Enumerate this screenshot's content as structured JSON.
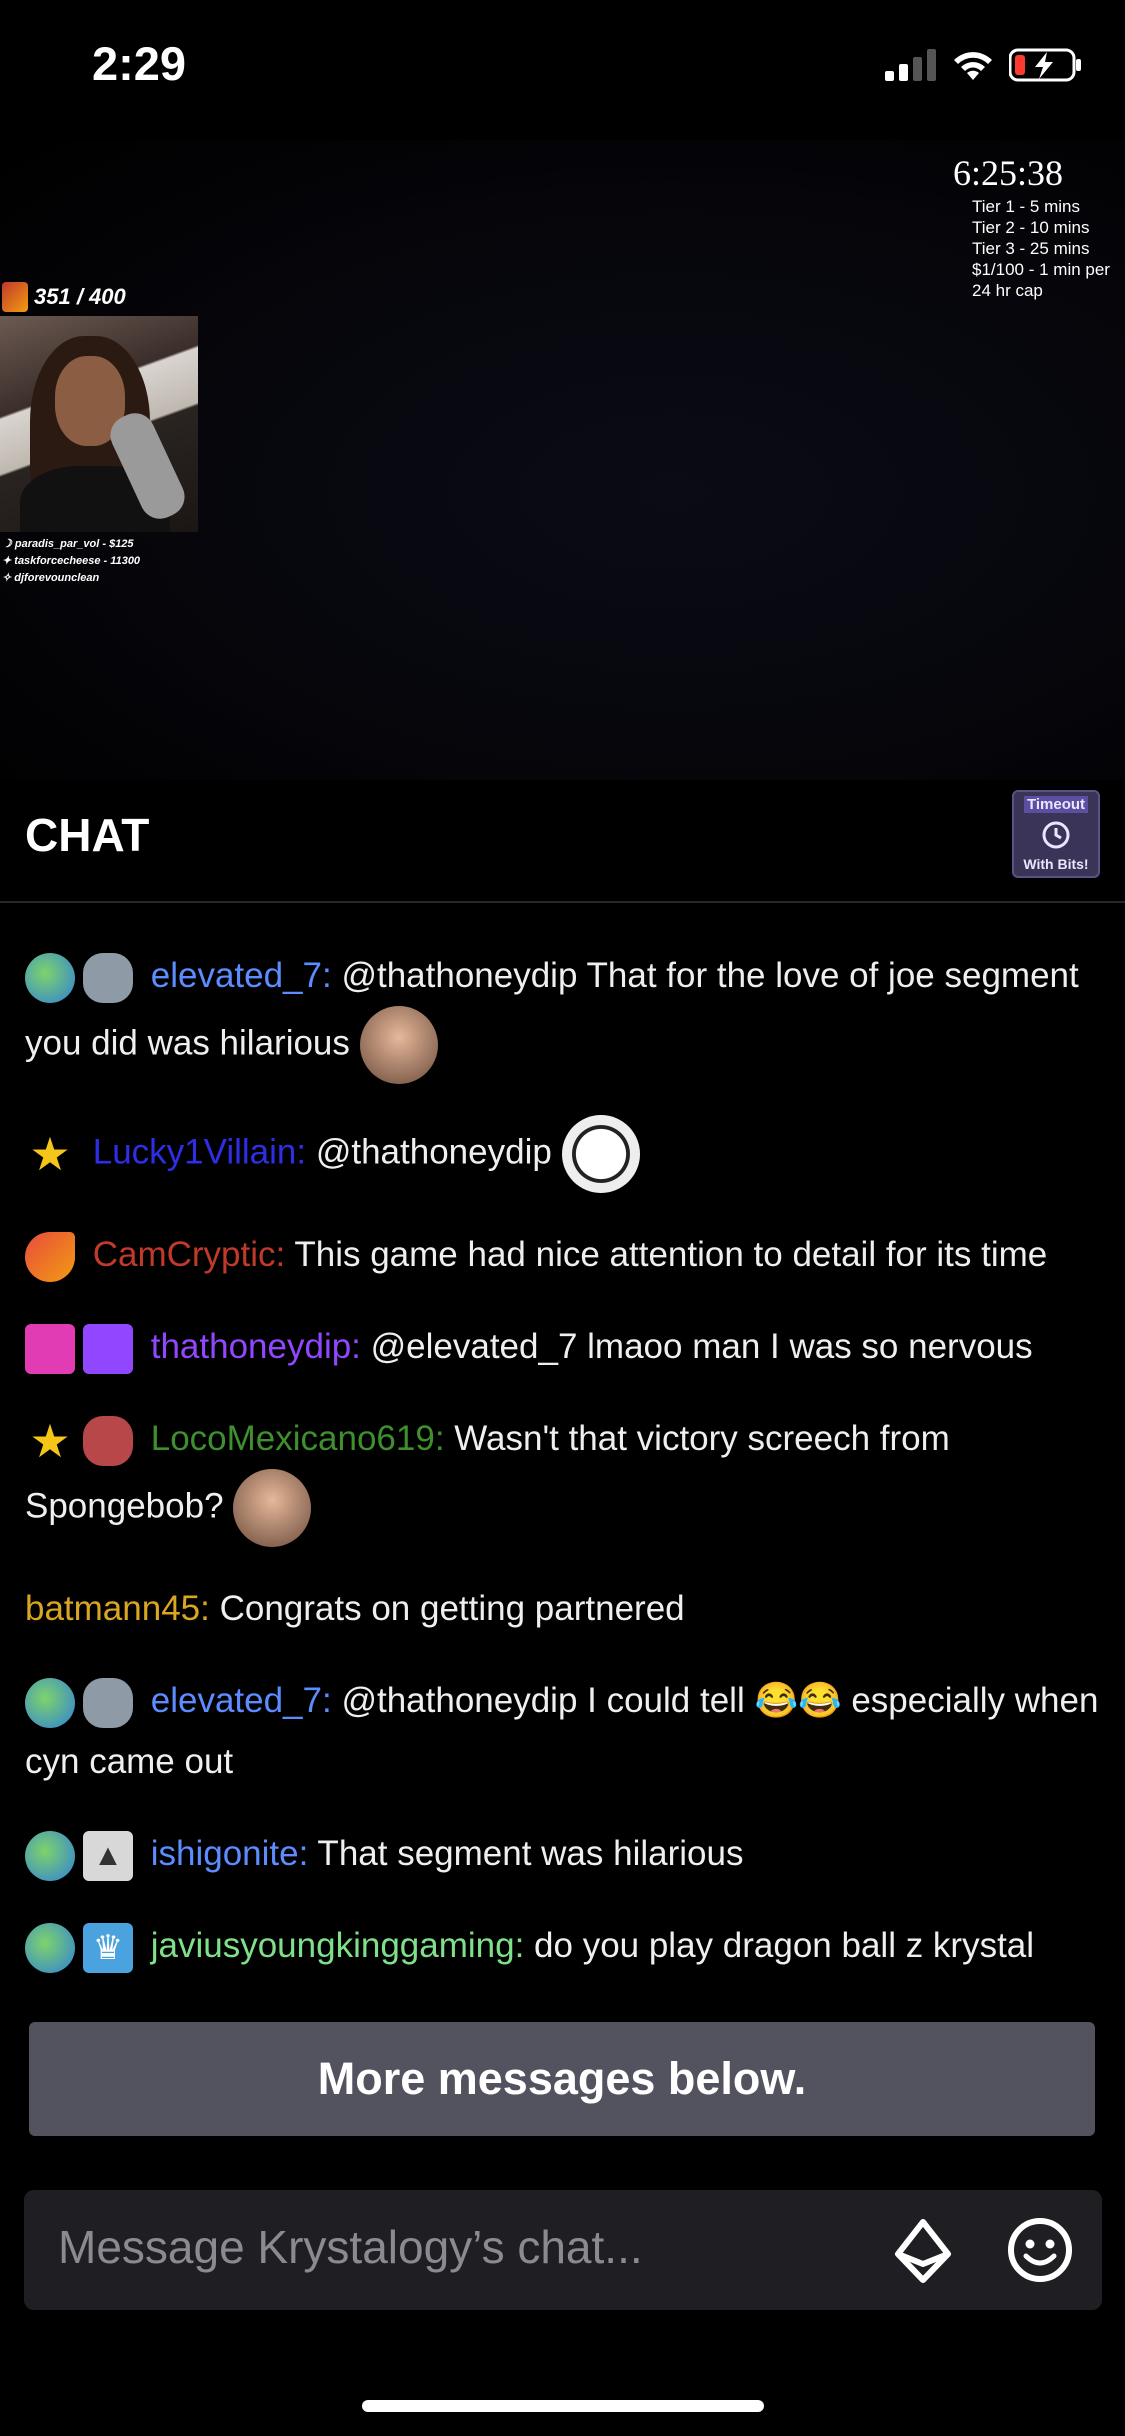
{
  "status_bar": {
    "time": "2:29",
    "icons": [
      "signal-icon",
      "wifi-icon",
      "battery-low-charging-icon"
    ]
  },
  "stream": {
    "clock": "6:25:38",
    "tiers": [
      "Tier 1 - 5 mins",
      "Tier 2 - 10 mins",
      "Tier 3 - 25 mins",
      "$1/100 - 1 min per",
      "24 hr cap"
    ],
    "goal": "351 / 400",
    "donors": [
      "paradis_par_vol - $125",
      "taskforcecheese - 11300",
      "djforevounclean"
    ]
  },
  "chat": {
    "title": "CHAT",
    "timeout_button": {
      "line1": "Timeout",
      "line2": "With Bits!"
    },
    "messages": [
      {
        "badges": [
          "globe-badge",
          "robot-badge"
        ],
        "user": "elevated_7:",
        "user_color": "#5c8cff",
        "text": " @thathoneydip That for the love of joe segment you did was hilarious ",
        "emotes": [
          "bearded-face-emote"
        ]
      },
      {
        "badges": [
          "star-badge"
        ],
        "user": "Lucky1Villain:",
        "user_color": "#2e2ee6",
        "text": " @thathoneydip ",
        "emotes": [
          "panda-emote"
        ]
      },
      {
        "badges": [
          "rocket-badge"
        ],
        "user": "CamCryptic:",
        "user_color": "#c0392b",
        "text": " This game had nice attention to detail for its time",
        "emotes": []
      },
      {
        "badges": [
          "diamond-badge",
          "verified-badge"
        ],
        "user": "thathoneydip:",
        "user_color": "#9147ff",
        "text": " @elevated_7 lmaoo man I was so nervous",
        "emotes": []
      },
      {
        "badges": [
          "star-badge",
          "robot-badge"
        ],
        "user": "LocoMexicano619:",
        "user_color": "#3f8f2f",
        "text": " Wasn't that victory screech from Spongebob? ",
        "emotes": [
          "bearded-face-emote"
        ]
      },
      {
        "badges": [],
        "user": "batmann45:",
        "user_color": "#daa520",
        "text": " Congrats on getting partnered",
        "emotes": []
      },
      {
        "badges": [
          "globe-badge",
          "robot-badge"
        ],
        "user": "elevated_7:",
        "user_color": "#5c8cff",
        "text": " @thathoneydip I could tell 😂😂 especially when cyn came out",
        "emotes": []
      },
      {
        "badges": [
          "globe-badge",
          "triangle-badge"
        ],
        "user": "ishigonite:",
        "user_color": "#5c8cff",
        "text": " That segment was hilarious",
        "emotes": []
      },
      {
        "badges": [
          "globe-badge",
          "crown-badge"
        ],
        "user": "javiusyoungkinggaming:",
        "user_color": "#7fe08a",
        "text": " do you play dragon ball z krystal",
        "emotes": []
      }
    ],
    "more_messages": "More messages below.",
    "input_placeholder": "Message Krystalogy’s chat..."
  },
  "colors": {
    "background": "#000000",
    "input_bg": "#1f1f23",
    "banner_bg": "#53535f",
    "accent": "#9147ff"
  }
}
